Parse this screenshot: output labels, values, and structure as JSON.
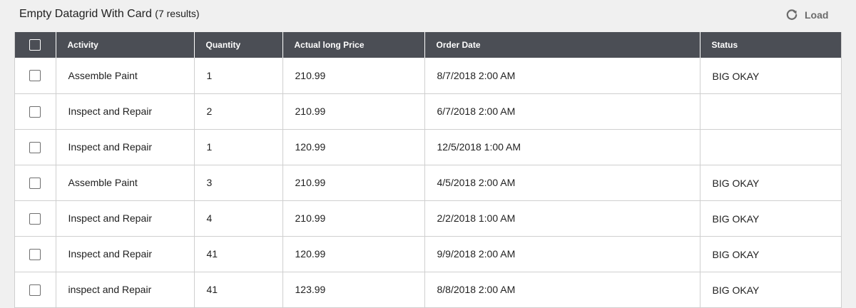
{
  "header": {
    "title": "Empty Datagrid With Card",
    "result_count": "(7 results)",
    "load_label": "Load",
    "load_icon": "refresh-icon"
  },
  "colors": {
    "page_bg": "#f0f0f0",
    "header_row_bg": "#4b4e55",
    "header_text": "#ffffff",
    "grid_border": "#cfcfcf",
    "load_text": "#6b6b6b"
  },
  "grid": {
    "columns": [
      "Activity",
      "Quantity",
      "Actual long Price",
      "Order Date",
      "Status"
    ],
    "rows": [
      {
        "activity": "Assemble Paint",
        "quantity": "1",
        "price": "210.99",
        "date": "8/7/2018 2:00 AM",
        "status": "BIG OKAY"
      },
      {
        "activity": "Inspect and Repair",
        "quantity": "2",
        "price": "210.99",
        "date": "6/7/2018 2:00 AM",
        "status": ""
      },
      {
        "activity": "Inspect and Repair",
        "quantity": "1",
        "price": "120.99",
        "date": "12/5/2018 1:00 AM",
        "status": ""
      },
      {
        "activity": "Assemble Paint",
        "quantity": "3",
        "price": "210.99",
        "date": "4/5/2018 2:00 AM",
        "status": "BIG OKAY"
      },
      {
        "activity": "Inspect and Repair",
        "quantity": "4",
        "price": "210.99",
        "date": "2/2/2018 1:00 AM",
        "status": "BIG OKAY"
      },
      {
        "activity": "Inspect and Repair",
        "quantity": "41",
        "price": "120.99",
        "date": "9/9/2018 2:00 AM",
        "status": "BIG OKAY"
      },
      {
        "activity": "inspect and Repair",
        "quantity": "41",
        "price": "123.99",
        "date": "8/8/2018 2:00 AM",
        "status": "BIG OKAY"
      }
    ]
  }
}
